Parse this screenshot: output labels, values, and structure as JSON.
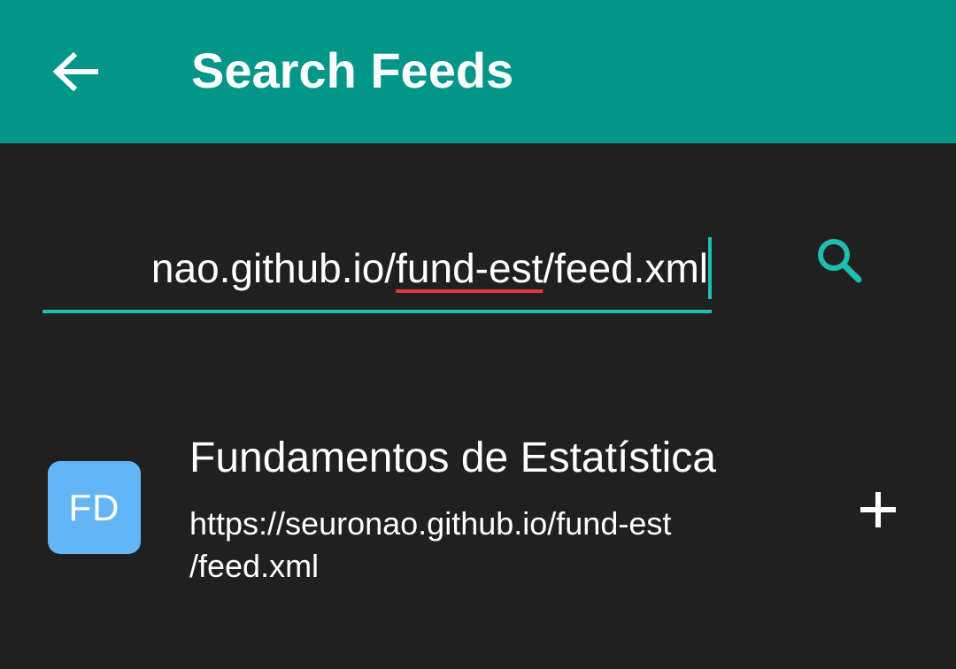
{
  "app_bar": {
    "title": "Search Feeds",
    "back_icon": "arrow-left-icon",
    "background": "#009688"
  },
  "search": {
    "value_prefix": "nao.github.io/",
    "value_misspelled": "fund-est",
    "value_suffix": "/feed.xml",
    "icon": "search-icon",
    "accent": "#1dbfae",
    "spellcheck_color": "#e53935"
  },
  "results": [
    {
      "avatar_text": "FD",
      "avatar_color": "#64b5f6",
      "title": "Fundamentos de Estatística",
      "url_line1": "https://seuronao.github.io/fund-est",
      "url_line2": "/feed.xml",
      "action_icon": "plus-icon"
    }
  ],
  "colors": {
    "background": "#202020",
    "text": "#ffffff"
  }
}
